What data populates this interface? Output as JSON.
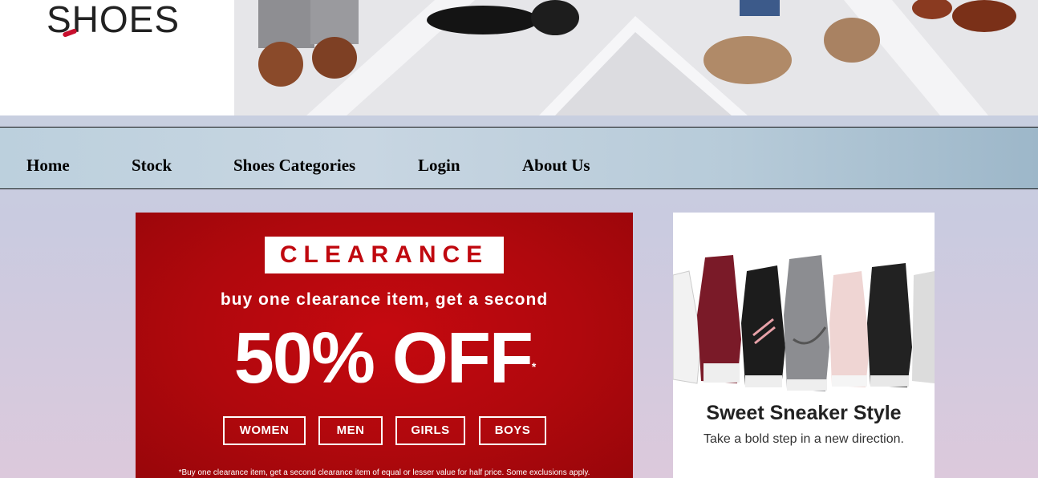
{
  "logo": {
    "text": "SHOES"
  },
  "hero": {
    "image": "men-dress-shoes-banner"
  },
  "nav": {
    "items": [
      {
        "label": "Home"
      },
      {
        "label": "Stock"
      },
      {
        "label": "Shoes Categories"
      },
      {
        "label": "Login"
      },
      {
        "label": "About Us"
      }
    ]
  },
  "clearance": {
    "badge": "CLEARANCE",
    "subtitle": "buy one clearance item, get a second",
    "headline": "50% OFF",
    "asterisk": "*",
    "buttons": [
      "WOMEN",
      "MEN",
      "GIRLS",
      "BOYS"
    ],
    "note": "*Buy one clearance item, get a second clearance item of equal or lesser value for half price. Some exclusions apply.",
    "color": "#b5080d"
  },
  "sneaker_ad": {
    "title": "Sweet Sneaker Style",
    "subtitle": "Take a bold step in a new direction."
  }
}
